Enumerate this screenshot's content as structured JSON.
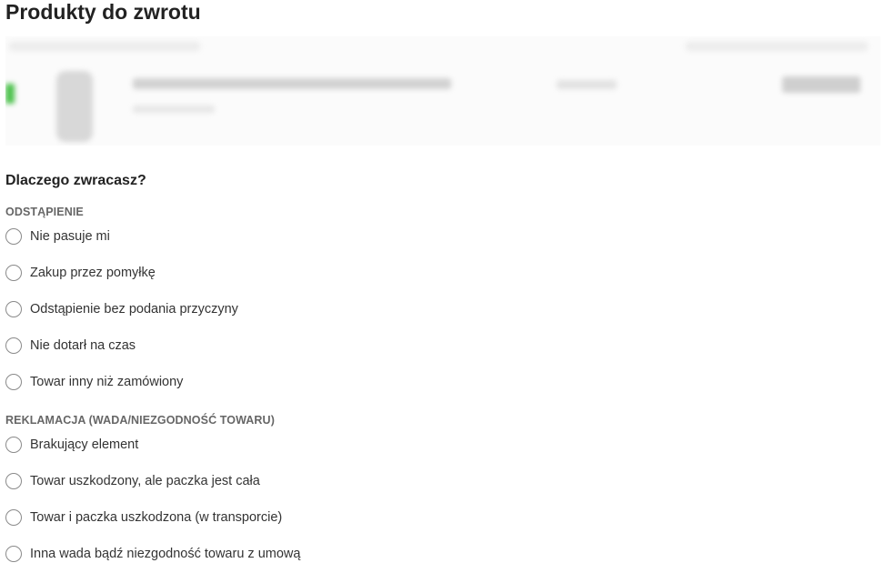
{
  "page": {
    "title": "Produkty do zwrotu"
  },
  "product_card": {
    "blurred": true,
    "accent_color": "#4cc24c"
  },
  "reason": {
    "question": "Dlaczego zwracasz?",
    "groups": [
      {
        "label": "ODSTĄPIENIE",
        "options": [
          {
            "label": "Nie pasuje mi",
            "selected": false
          },
          {
            "label": "Zakup przez pomyłkę",
            "selected": false
          },
          {
            "label": "Odstąpienie bez podania przyczyny",
            "selected": false
          },
          {
            "label": "Nie dotarł na czas",
            "selected": false
          },
          {
            "label": "Towar inny niż zamówiony",
            "selected": false
          }
        ]
      },
      {
        "label": "REKLAMACJA (WADA/NIEZGODNOŚĆ TOWARU)",
        "options": [
          {
            "label": "Brakujący element",
            "selected": false
          },
          {
            "label": "Towar uszkodzony, ale paczka jest cała",
            "selected": false
          },
          {
            "label": "Towar i paczka uszkodzona (w transporcie)",
            "selected": false
          },
          {
            "label": "Inna wada bądź niezgodność towaru z umową",
            "selected": false
          }
        ]
      }
    ]
  }
}
